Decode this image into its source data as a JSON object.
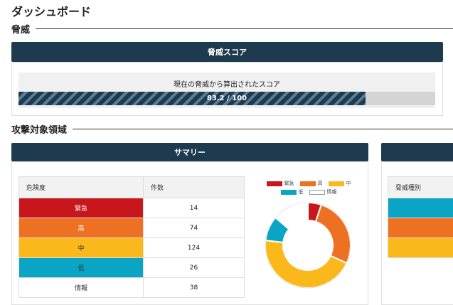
{
  "page": {
    "title": "ダッシュボード"
  },
  "sections": {
    "threat": "脅威",
    "attack_surface": "攻撃対象領域"
  },
  "threat_score": {
    "header": "脅威スコア",
    "caption": "現在の脅威から算出されたスコア",
    "value": 83.2,
    "max": 100,
    "display": "83.2 / 100",
    "fill_fraction": 0.832
  },
  "summary": {
    "header": "サマリー",
    "table": {
      "columns": [
        "危険度",
        "件数"
      ],
      "rows": [
        {
          "level": "緊急",
          "count": "14",
          "color": "#c8161d",
          "text_color": "#ffffff"
        },
        {
          "level": "高",
          "count": "74",
          "color": "#ee7023",
          "text_color": "#ffffff"
        },
        {
          "level": "中",
          "count": "124",
          "color": "#fbb81b",
          "text_color": "#333333"
        },
        {
          "level": "低",
          "count": "26",
          "color": "#0aa5c5",
          "text_color": "#333333"
        },
        {
          "level": "情報",
          "count": "38",
          "color": "#ffffff",
          "text_color": "#333333"
        }
      ]
    }
  },
  "chart_data": {
    "type": "pie",
    "variant": "donut",
    "categories": [
      "緊急",
      "高",
      "中",
      "低",
      "情報"
    ],
    "values": [
      14,
      74,
      124,
      26,
      38
    ],
    "colors": [
      "#c8161d",
      "#ee7023",
      "#fbb81b",
      "#0aa5c5",
      "#ffffff"
    ],
    "legend_position": "top"
  },
  "right_panel": {
    "table": {
      "columns": [
        "脅威種別"
      ],
      "rows": [
        {
          "color": "#0aa5c5"
        },
        {
          "color": "#ee7023"
        },
        {
          "color": "#fbb81b"
        }
      ]
    }
  }
}
